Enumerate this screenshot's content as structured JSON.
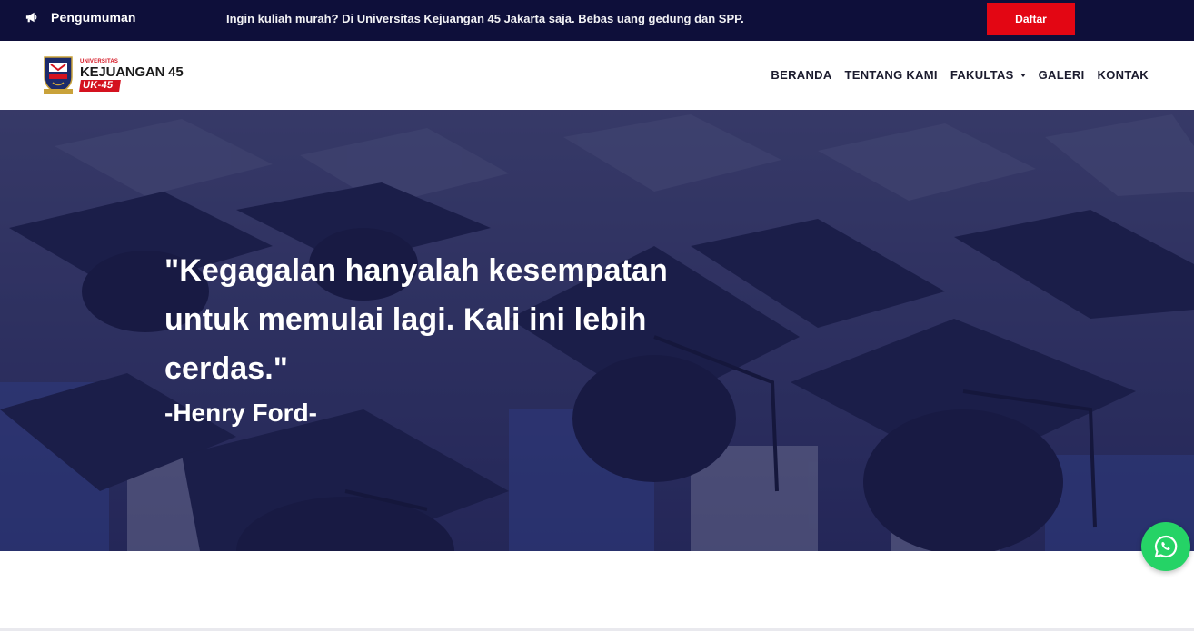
{
  "announcement": {
    "icon": "megaphone-icon",
    "title": "Pengumuman",
    "text": "Ingin kuliah murah? Di Universitas Kejuangan 45 Jakarta saja. Bebas uang gedung dan SPP.",
    "button_label": "Daftar",
    "colors": {
      "bar": "#0e0f3a",
      "button": "#e30613"
    }
  },
  "logo": {
    "small": "UNIVERSITAS",
    "main": "KEJUANGAN 45",
    "tag": "UK-45"
  },
  "nav": {
    "items": [
      {
        "label": "BERANDA"
      },
      {
        "label": "TENTANG KAMI"
      },
      {
        "label": "FAKULTAS",
        "has_dropdown": true
      },
      {
        "label": "GALERI"
      },
      {
        "label": "KONTAK"
      }
    ]
  },
  "hero": {
    "quote": "\"Kegagalan hanyalah kesempatan untuk memulai lagi. Kali ini lebih cerdas.\"",
    "author": "-Henry Ford-",
    "background": "graduation-caps-photo"
  },
  "whatsapp": {
    "icon": "whatsapp-icon",
    "color": "#25d366"
  }
}
